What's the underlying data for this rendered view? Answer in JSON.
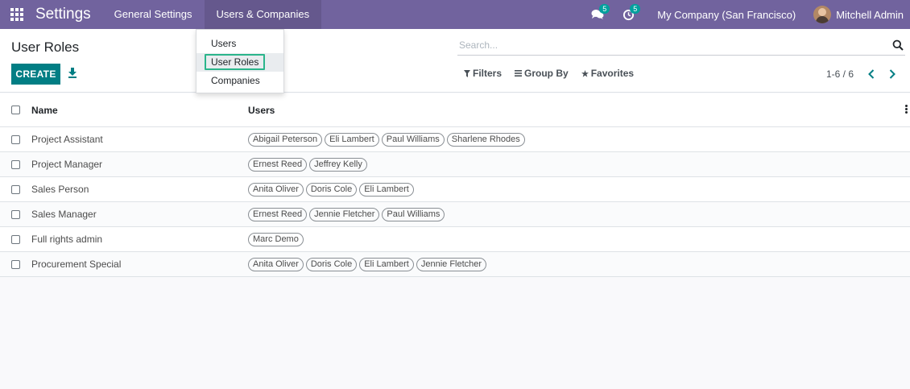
{
  "navbar": {
    "app_name": "Settings",
    "menu": [
      "General Settings",
      "Users & Companies"
    ],
    "messages_count": "5",
    "activities_count": "5",
    "company": "My Company (San Francisco)",
    "user": "Mitchell Admin"
  },
  "dropdown": {
    "items": [
      "Users",
      "User Roles",
      "Companies"
    ]
  },
  "control_panel": {
    "title": "User Roles",
    "create_label": "CREATE",
    "search_placeholder": "Search...",
    "filters_label": "Filters",
    "groupby_label": "Group By",
    "favorites_label": "Favorites",
    "pager": "1-6 / 6"
  },
  "list": {
    "columns": [
      "Name",
      "Users"
    ],
    "rows": [
      {
        "name": "Project Assistant",
        "users": [
          "Abigail Peterson",
          "Eli Lambert",
          "Paul Williams",
          "Sharlene Rhodes"
        ]
      },
      {
        "name": "Project Manager",
        "users": [
          "Ernest Reed",
          "Jeffrey Kelly"
        ]
      },
      {
        "name": "Sales Person",
        "users": [
          "Anita Oliver",
          "Doris Cole",
          "Eli Lambert"
        ]
      },
      {
        "name": "Sales Manager",
        "users": [
          "Ernest Reed",
          "Jennie Fletcher",
          "Paul Williams"
        ]
      },
      {
        "name": "Full rights admin",
        "users": [
          "Marc Demo"
        ]
      },
      {
        "name": "Procurement Special",
        "users": [
          "Anita Oliver",
          "Doris Cole",
          "Eli Lambert",
          "Jennie Fletcher"
        ]
      }
    ]
  },
  "colors": {
    "navbar": "#71639e",
    "primary_button": "#017e84",
    "badge": "#00a09d",
    "dropdown_highlight": "#2bb58b"
  }
}
